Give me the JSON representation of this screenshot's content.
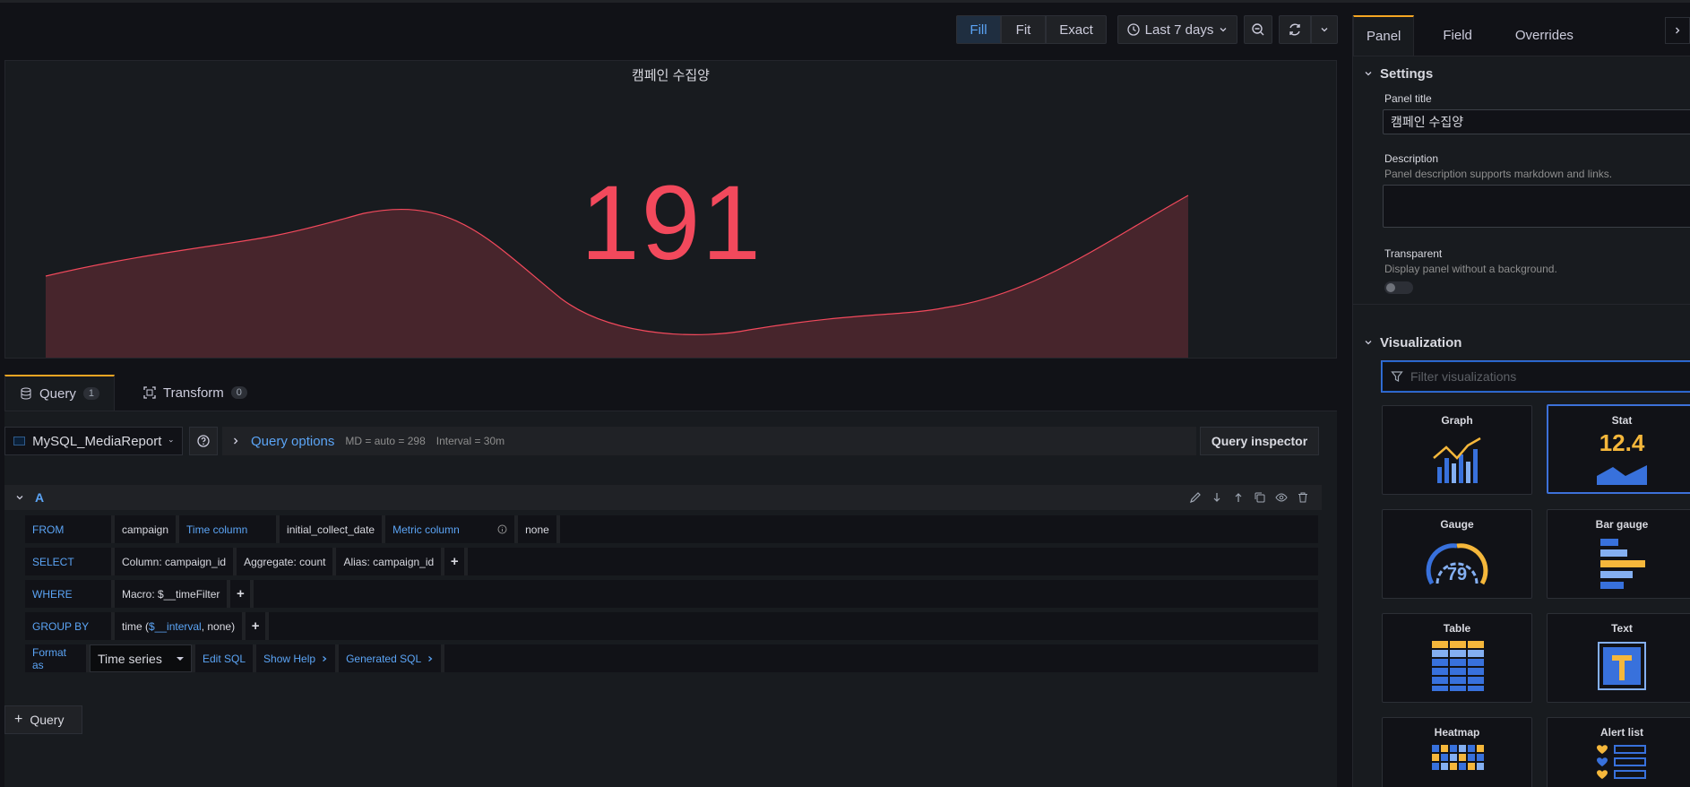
{
  "toolbar": {
    "fill": "Fill",
    "fit": "Fit",
    "exact": "Exact",
    "time_range": "Last 7 days"
  },
  "panel": {
    "title": "캠페인 수집양",
    "value": "191",
    "value_color": "#f2495c"
  },
  "query_tabs": [
    {
      "label": "Query",
      "count": "1"
    },
    {
      "label": "Transform",
      "count": "0"
    }
  ],
  "datasource": "MySQL_MediaReport",
  "query_options": {
    "label": "Query options",
    "md": "MD = auto = 298",
    "interval": "Interval = 30m"
  },
  "query_inspector": "Query inspector",
  "query_a": {
    "name": "A",
    "from": {
      "kw": "FROM",
      "table": "campaign",
      "time_col_label": "Time column",
      "time_col": "initial_collect_date",
      "metric_label": "Metric column",
      "metric": "none"
    },
    "select": {
      "kw": "SELECT",
      "column": "Column: campaign_id",
      "aggregate": "Aggregate: count",
      "alias": "Alias: campaign_id"
    },
    "where": {
      "kw": "WHERE",
      "macro": "Macro: $__timeFilter"
    },
    "group_by": {
      "kw": "GROUP BY",
      "pre": "time (",
      "var": "$__interval",
      "post": ", none)"
    },
    "format": {
      "label": "Format as",
      "value": "Time series",
      "edit_sql": "Edit SQL",
      "show_help": "Show Help",
      "generated_sql": "Generated SQL"
    }
  },
  "add_query": "Query",
  "options_pane": {
    "tabs": [
      "Panel",
      "Field",
      "Overrides"
    ],
    "settings": {
      "header": "Settings",
      "panel_title_label": "Panel title",
      "panel_title_value": "캠페인 수집양",
      "description_label": "Description",
      "description_help": "Panel description supports markdown and links.",
      "transparent_label": "Transparent",
      "transparent_help": "Display panel without a background."
    },
    "visualization": {
      "header": "Visualization",
      "filter_placeholder": "Filter visualizations",
      "items": [
        "Graph",
        "Stat",
        "Gauge",
        "Bar gauge",
        "Table",
        "Text",
        "Heatmap",
        "Alert list"
      ],
      "selected": "Stat",
      "stat_preview": "12.4",
      "gauge_preview": "79"
    }
  },
  "colors": {
    "accent": "#5ba4f5",
    "active_tab": "#f5a623",
    "value": "#f2495c"
  }
}
